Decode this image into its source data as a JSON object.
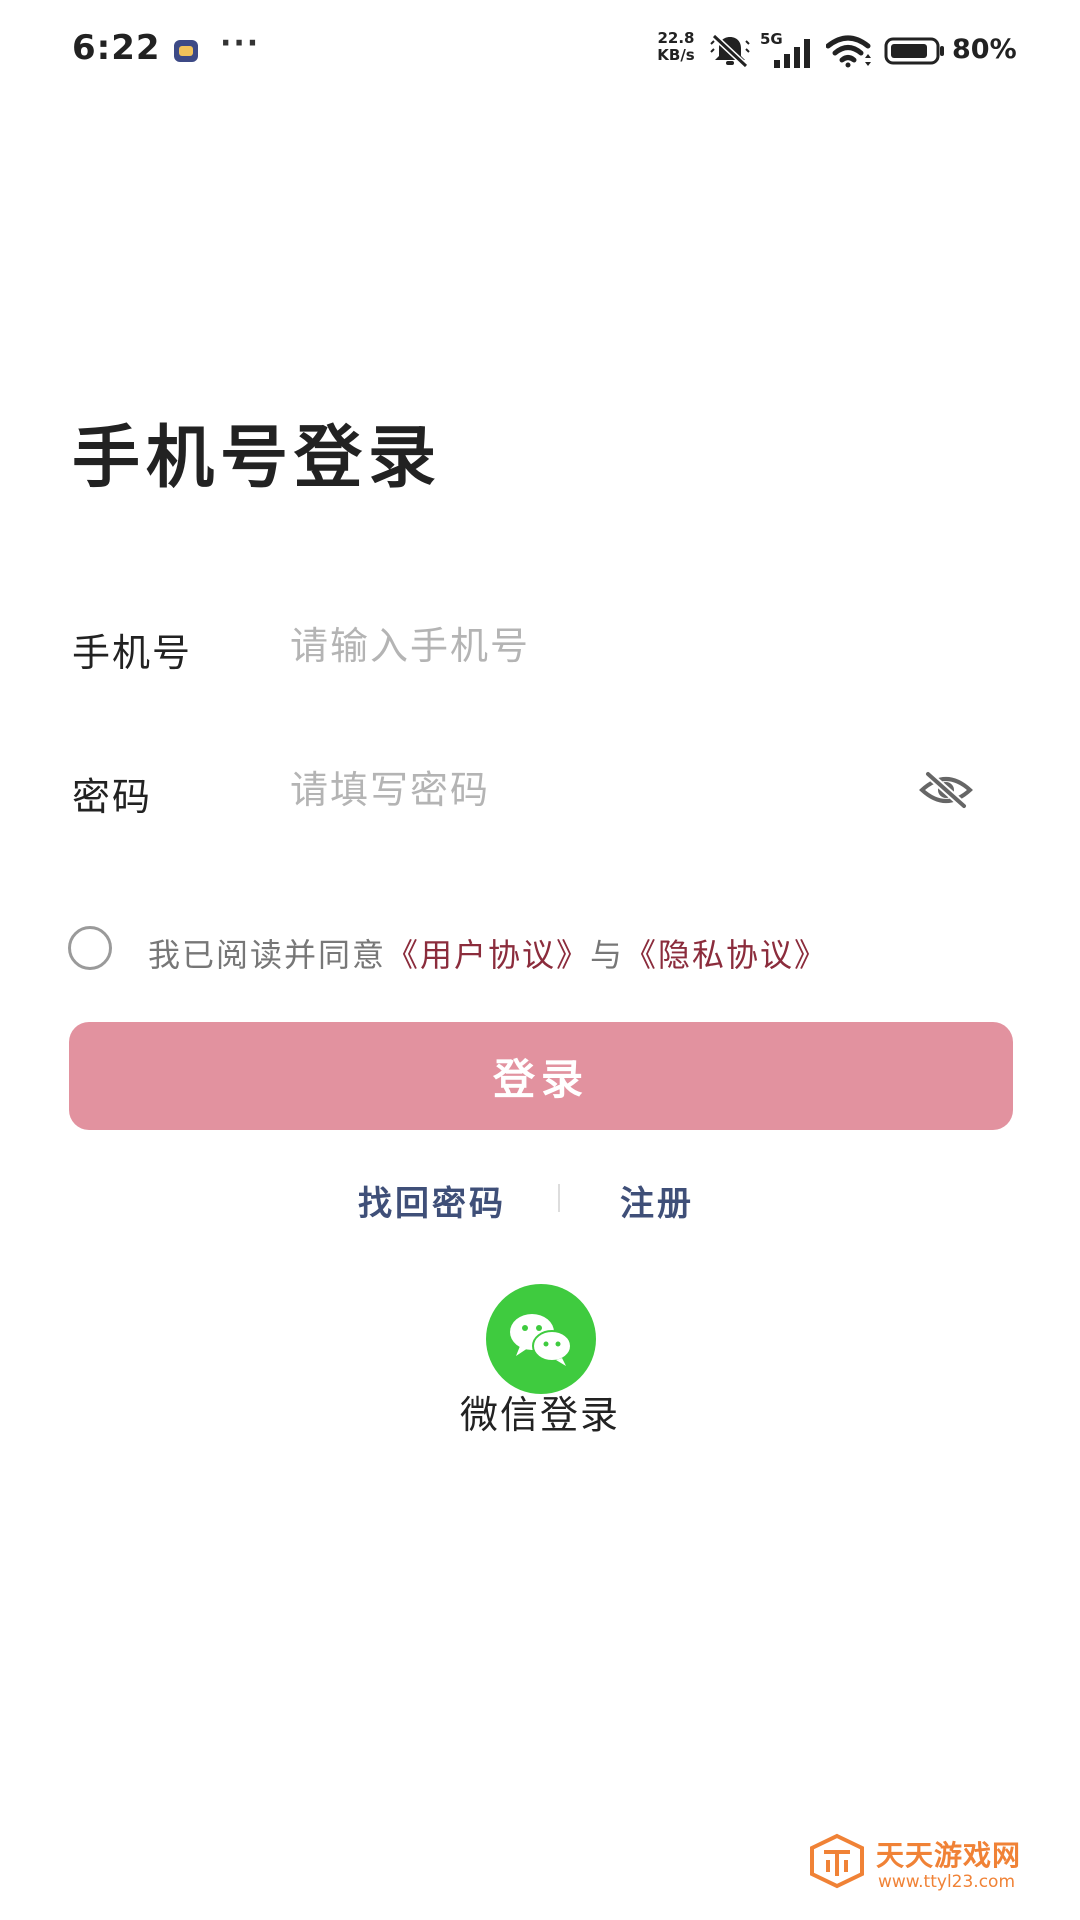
{
  "status_bar": {
    "time": "6:22",
    "more": "···",
    "net_speed_value": "22.8",
    "net_speed_unit": "KB/s",
    "network_type": "5G",
    "battery": "80%"
  },
  "title": "手机号登录",
  "phone": {
    "label": "手机号",
    "placeholder": "请输入手机号"
  },
  "password": {
    "label": "密码",
    "placeholder": "请填写密码"
  },
  "agreement": {
    "prefix": "我已阅读并同意",
    "user_agreement": "《用户协议》",
    "connector": "与",
    "privacy_agreement": "《隐私协议》"
  },
  "login_button": "登录",
  "links": {
    "forgot_password": "找回密码",
    "register": "注册"
  },
  "wechat": {
    "label": "微信登录"
  },
  "watermark": {
    "name": "天天游戏网",
    "url": "www.ttyl23.com"
  },
  "colors": {
    "login_button_bg": "#e2929f",
    "agreement_link": "#8b2c3c",
    "link_text": "#3f4f78",
    "wechat_green": "#3fcb3f",
    "watermark_orange": "#f08236"
  },
  "icons": [
    "app-notification-icon",
    "mute-icon",
    "signal-icon",
    "wifi-icon",
    "battery-icon",
    "eye-off-icon",
    "wechat-icon",
    "watermark-logo-icon"
  ]
}
